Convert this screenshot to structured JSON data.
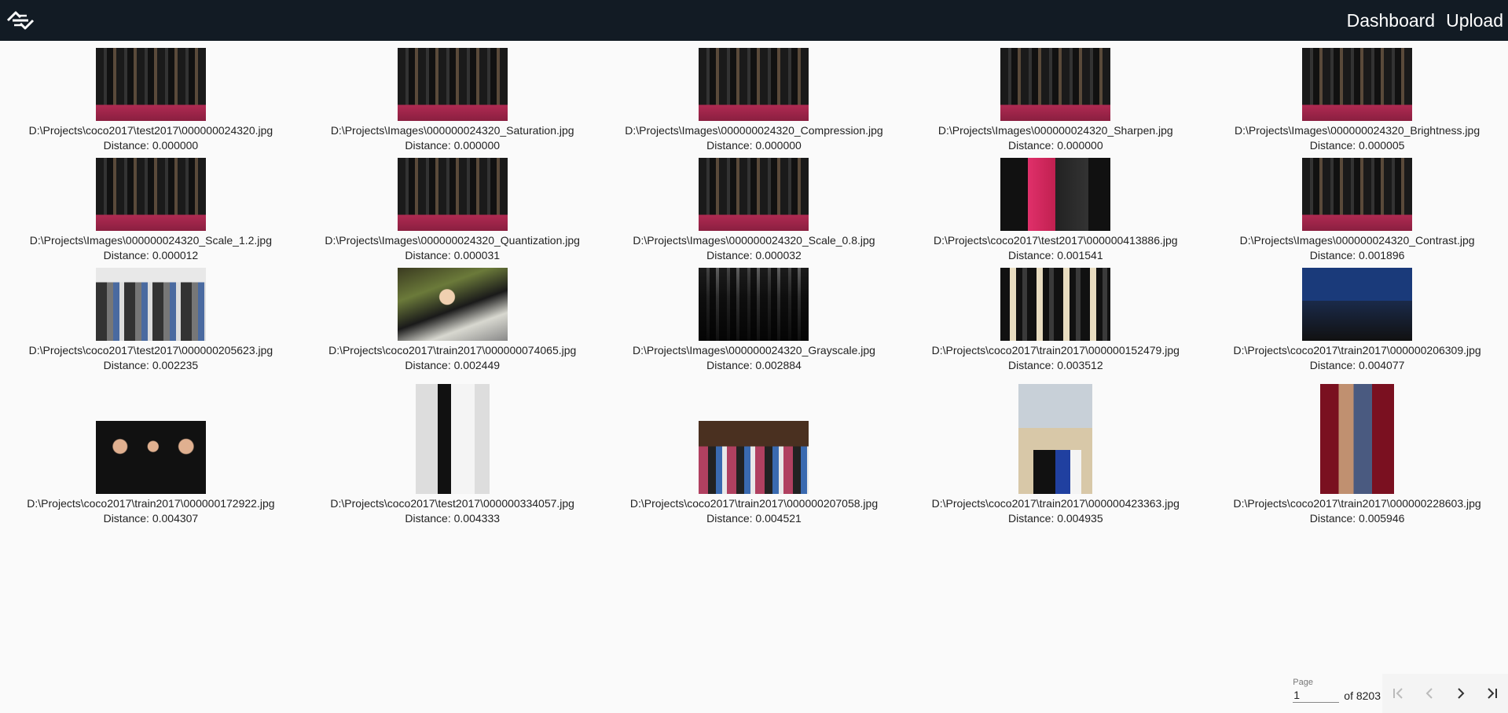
{
  "header": {
    "logo_icon": "link-swap-icon",
    "nav": [
      "Dashboard",
      "Upload"
    ]
  },
  "results": [
    [
      {
        "path": "D:\\Projects\\coco2017\\test2017\\000000024320.jpg",
        "distance": "Distance: 0.000000",
        "style": "t-group"
      },
      {
        "path": "D:\\Projects\\Images\\000000024320_Saturation.jpg",
        "distance": "Distance: 0.000000",
        "style": "t-group"
      },
      {
        "path": "D:\\Projects\\Images\\000000024320_Compression.jpg",
        "distance": "Distance: 0.000000",
        "style": "t-group"
      },
      {
        "path": "D:\\Projects\\Images\\000000024320_Sharpen.jpg",
        "distance": "Distance: 0.000000",
        "style": "t-group"
      },
      {
        "path": "D:\\Projects\\Images\\000000024320_Brightness.jpg",
        "distance": "Distance: 0.000005",
        "style": "t-group"
      }
    ],
    [
      {
        "path": "D:\\Projects\\Images\\000000024320_Scale_1.2.jpg",
        "distance": "Distance: 0.000012",
        "style": "t-group"
      },
      {
        "path": "D:\\Projects\\Images\\000000024320_Quantization.jpg",
        "distance": "Distance: 0.000031",
        "style": "t-group"
      },
      {
        "path": "D:\\Projects\\Images\\000000024320_Scale_0.8.jpg",
        "distance": "Distance: 0.000032",
        "style": "t-group"
      },
      {
        "path": "D:\\Projects\\coco2017\\test2017\\000000413886.jpg",
        "distance": "Distance: 0.001541",
        "style": "t-red"
      },
      {
        "path": "D:\\Projects\\Images\\000000024320_Contrast.jpg",
        "distance": "Distance: 0.001896",
        "style": "t-group"
      }
    ],
    [
      {
        "path": "D:\\Projects\\coco2017\\test2017\\000000205623.jpg",
        "distance": "Distance: 0.002235",
        "style": "t-bench"
      },
      {
        "path": "D:\\Projects\\coco2017\\train2017\\000000074065.jpg",
        "distance": "Distance: 0.002449",
        "style": "t-train"
      },
      {
        "path": "D:\\Projects\\Images\\000000024320_Grayscale.jpg",
        "distance": "Distance: 0.002884",
        "style": "t-gray"
      },
      {
        "path": "D:\\Projects\\coco2017\\train2017\\000000152479.jpg",
        "distance": "Distance: 0.003512",
        "style": "t-band"
      },
      {
        "path": "D:\\Projects\\coco2017\\train2017\\000000206309.jpg",
        "distance": "Distance: 0.004077",
        "style": "t-press"
      }
    ],
    [
      {
        "path": "D:\\Projects\\coco2017\\train2017\\000000172922.jpg",
        "distance": "Distance: 0.004307",
        "style": "t-trio"
      },
      {
        "path": "D:\\Projects\\coco2017\\test2017\\000000334057.jpg",
        "distance": "Distance: 0.004333",
        "style": "t-wedding"
      },
      {
        "path": "D:\\Projects\\coco2017\\train2017\\000000207058.jpg",
        "distance": "Distance: 0.004521",
        "style": "t-church"
      },
      {
        "path": "D:\\Projects\\coco2017\\train2017\\000000423363.jpg",
        "distance": "Distance: 0.004935",
        "style": "t-beach"
      },
      {
        "path": "D:\\Projects\\coco2017\\train2017\\000000228603.jpg",
        "distance": "Distance: 0.005946",
        "style": "t-curtain"
      }
    ]
  ],
  "pagination": {
    "label": "Page",
    "value": "1",
    "of_text": "of 8203",
    "buttons": [
      "first-page-icon",
      "previous-page-icon",
      "next-page-icon",
      "last-page-icon"
    ]
  }
}
